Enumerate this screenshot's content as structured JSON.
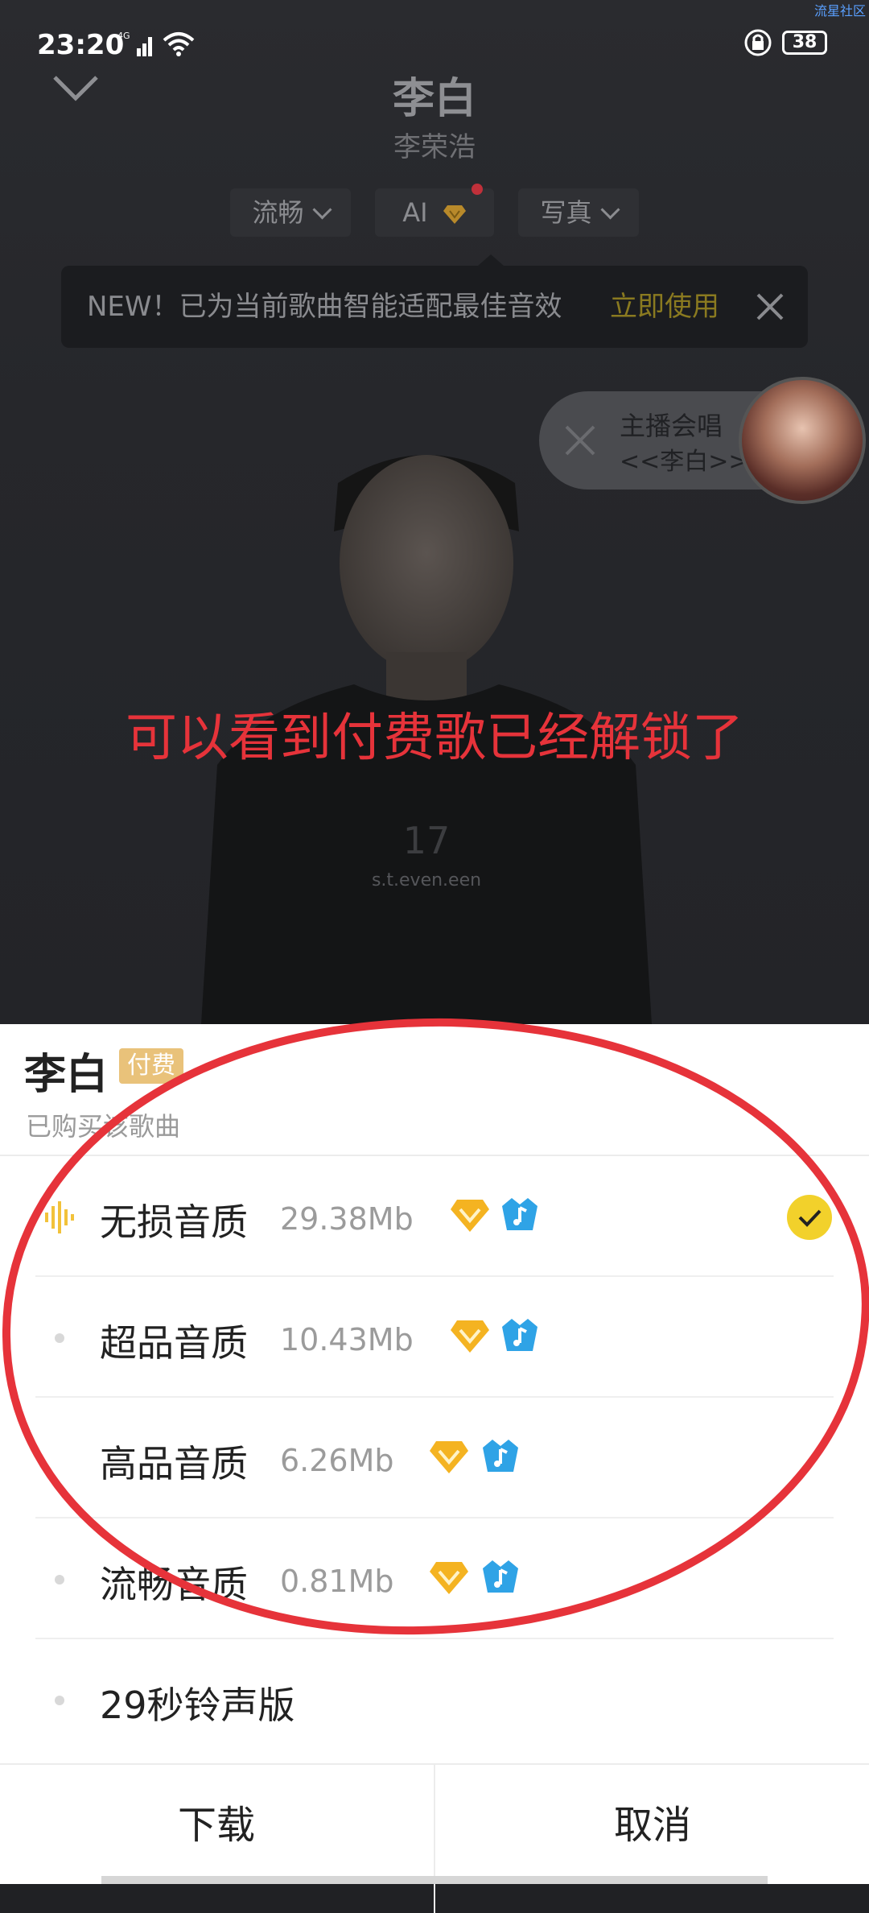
{
  "status_bar": {
    "time": "23:20",
    "network": "4G",
    "battery": "38",
    "corner_text": "流星社区"
  },
  "player": {
    "title": "李白",
    "artist": "李荣浩",
    "chips": [
      {
        "label": "流畅"
      },
      {
        "label": "AI"
      },
      {
        "label": "写真"
      }
    ],
    "tooltip": {
      "text": "NEW！已为当前歌曲智能适配最佳音效",
      "action": "立即使用"
    },
    "anchor_pill": {
      "label": "主播会唱",
      "sub": "<<李白>>"
    },
    "overlay_annotation": "可以看到付费歌已经解锁了"
  },
  "sheet": {
    "title": "李白",
    "badge": "付费",
    "subtitle": "已购买该歌曲",
    "options": [
      {
        "label": "无损音质",
        "size": "29.38Mb",
        "selected": true
      },
      {
        "label": "超品音质",
        "size": "10.43Mb",
        "selected": false
      },
      {
        "label": "高品音质",
        "size": "6.26Mb",
        "selected": false
      },
      {
        "label": "流畅音质",
        "size": "0.81Mb",
        "selected": false
      },
      {
        "label": "29秒铃声版",
        "size": "",
        "selected": false
      }
    ],
    "actions": {
      "download": "下载",
      "cancel": "取消"
    }
  },
  "colors": {
    "accent_yellow": "#f2d12b",
    "paid_badge": "#e9c27a",
    "annotation_red": "#e6333a"
  }
}
